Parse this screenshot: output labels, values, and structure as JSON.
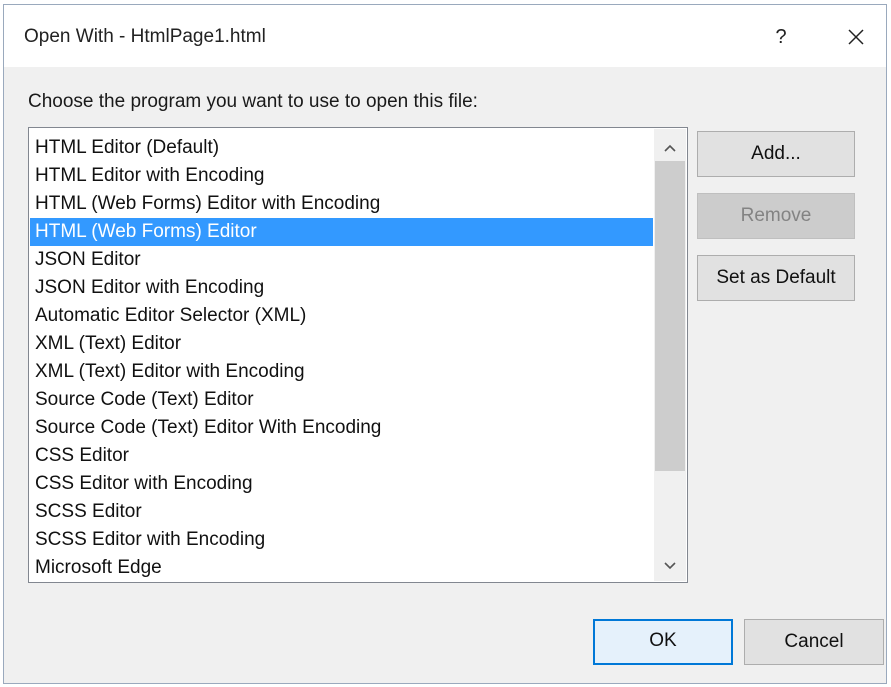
{
  "window": {
    "title": "Open With - HtmlPage1.html",
    "help_label": "?"
  },
  "prompt": "Choose the program you want to use to open this file:",
  "programs": [
    "HTML Editor (Default)",
    "HTML Editor with Encoding",
    "HTML (Web Forms) Editor with Encoding",
    "HTML (Web Forms) Editor",
    "JSON Editor",
    "JSON Editor with Encoding",
    "Automatic Editor Selector (XML)",
    "XML (Text) Editor",
    "XML (Text) Editor with Encoding",
    "Source Code (Text) Editor",
    "Source Code (Text) Editor With Encoding",
    "CSS Editor",
    "CSS Editor with Encoding",
    "SCSS Editor",
    "SCSS Editor with Encoding",
    "Microsoft Edge"
  ],
  "selected_program": "HTML (Web Forms) Editor",
  "buttons": {
    "add": "Add...",
    "remove": "Remove",
    "set_default": "Set as Default",
    "ok": "OK",
    "cancel": "Cancel"
  },
  "icons": {
    "close": "close-icon",
    "scroll_up": "chevron-up-icon",
    "scroll_down": "chevron-down-icon"
  },
  "colors": {
    "selection": "#3399ff",
    "focus_border": "#0078d7"
  }
}
